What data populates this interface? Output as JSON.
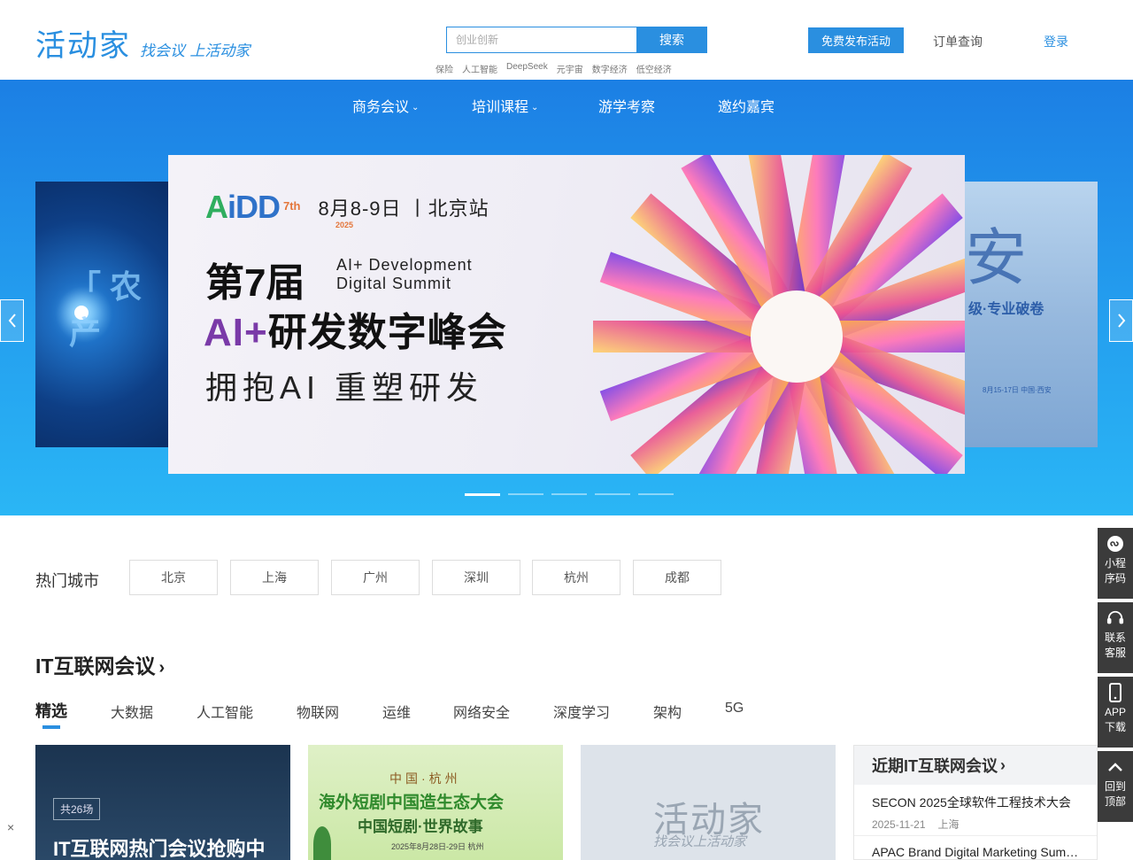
{
  "header": {
    "logo_main": "活动家",
    "logo_slogan": "找会议 上活动家",
    "search_placeholder": "创业创新",
    "search_button": "搜索",
    "hot_keywords": [
      "保险",
      "人工智能",
      "DeepSeek",
      "元宇宙",
      "数字经济",
      "低空经济"
    ],
    "publish_button": "免费发布活动",
    "order_link": "订单查询",
    "login_link": "登录"
  },
  "nav": [
    {
      "label": "商务会议",
      "has_dropdown": true
    },
    {
      "label": "培训课程",
      "has_dropdown": true
    },
    {
      "label": "游学考察",
      "has_dropdown": false
    },
    {
      "label": "邀约嘉宾",
      "has_dropdown": false
    }
  ],
  "banner": {
    "left_slide_text": "「 农产",
    "right_slide_big": "安",
    "right_slide_sub": "级·专业破卷",
    "right_slide_tiny": "8月15-17日 中国·西安",
    "aidd_logo_a": "A",
    "aidd_logo_dd": "iDD",
    "aidd_edition": "7th",
    "aidd_year": "2025",
    "date": "8月8-9日 丨北京站",
    "edition": "第7届",
    "en_line1": "AI+ Development",
    "en_line2": "Digital Summit",
    "title_ai": "AI+",
    "title_rest": "研发数字峰会",
    "slogan": "拥抱AI 重塑研发",
    "dot_count": 5,
    "active_dot": 0,
    "colors": {
      "bg_top": "#1c7fe4",
      "bg_bottom": "#2ab6f5"
    }
  },
  "cities": {
    "label": "热门城市",
    "items": [
      "北京",
      "上海",
      "广州",
      "深圳",
      "杭州",
      "成都"
    ]
  },
  "it_section": {
    "title": "IT互联网会议",
    "tabs": [
      "精选",
      "大数据",
      "人工智能",
      "物联网",
      "运维",
      "网络安全",
      "深度学习",
      "架构",
      "5G"
    ],
    "active_tab": 0,
    "cards": [
      {
        "count_badge": "共26场",
        "title": "IT互联网热门会议抢购中"
      },
      {
        "line1": "中国·杭州",
        "line2": "海外短剧中国造生态大会",
        "line3": "中国短剧·世界故事",
        "line4": "2025年8月28日-29日 杭州"
      },
      {
        "logo_main": "活动家",
        "logo_slogan": "找会议上活动家"
      }
    ],
    "recent": {
      "title": "近期IT互联网会议",
      "items": [
        {
          "title": "SECON 2025全球软件工程技术大会",
          "date": "2025-11-21",
          "city": "上海"
        },
        {
          "title": "APAC Brand Digital Marketing Summit",
          "date": "",
          "city": ""
        }
      ]
    }
  },
  "float_bar": [
    {
      "icon": "mini-program-icon",
      "label_1": "小程",
      "label_2": "序码"
    },
    {
      "icon": "headset-icon",
      "label_1": "联系",
      "label_2": "客服"
    },
    {
      "icon": "phone-icon",
      "label_1": "APP",
      "label_2": "下载"
    },
    {
      "icon": "chevron-up-icon",
      "label_1": "回到",
      "label_2": "顶部"
    }
  ],
  "close_symbol": "×",
  "accent_color": "#2a8fe0"
}
